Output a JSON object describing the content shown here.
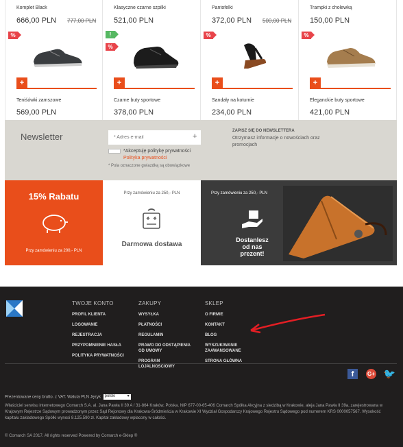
{
  "products": [
    {
      "top_name": "Komplet Black",
      "top_price": "666,00 PLN",
      "top_old_price": "777,00 PLN",
      "badges": [
        "sale"
      ],
      "name": "Teniśówki zamszowe",
      "price": "569,00 PLN",
      "shoe": "dark-sneaker-icon"
    },
    {
      "top_name": "Klasyczne czarne szpilki",
      "top_price": "521,00 PLN",
      "top_old_price": "",
      "badges": [
        "new",
        "sale"
      ],
      "name": "Czarne buty sportowe",
      "price": "378,00 PLN",
      "shoe": "black-sport-shoe-icon"
    },
    {
      "top_name": "Pantofelki",
      "top_price": "372,00 PLN",
      "top_old_price": "500,00 PLN",
      "badges": [
        "sale"
      ],
      "name": "Sandały na koturnie",
      "price": "234,00 PLN",
      "shoe": "wedge-sandal-icon"
    },
    {
      "top_name": "Trampki z cholewką",
      "top_price": "150,00 PLN",
      "top_old_price": "",
      "badges": [
        "sale"
      ],
      "name": "Eleganckie buty sportowe",
      "price": "421,00 PLN",
      "shoe": "tan-sneaker-icon"
    }
  ],
  "badge_text": {
    "sale": "%",
    "new": "!"
  },
  "add_label": "+",
  "newsletter": {
    "title": "Newsletter",
    "email_placeholder": "* Adres e-mail",
    "consent": "*Akceptuję politykę prywatności",
    "policy_link": "Polityka prywatności",
    "required_note": "* Pola oznaczone gwiazdką są obowiązkowe",
    "right_title": "ZAPISZ SIĘ DO NEWSLETTERA",
    "right_text": "Otrzymasz informacje o nowościach oraz promocjach"
  },
  "banners": {
    "discount_title": "15% Rabatu",
    "discount_text": "Przy zamówieniu za 200,- PLN",
    "delivery_text": "Przy zamówieniu za 250,- PLN",
    "delivery_title": "Darmowa dostawa",
    "photo_text": "Przy zamówieniu za 250,- PLN",
    "photo_title": "Dostanlesz od nas prezent!"
  },
  "footer": {
    "cols": [
      {
        "title": "TWOJE KONTO",
        "links": [
          "PROFIL KLIENTA",
          "LOGOWANIE",
          "REJESTRACJA",
          "PRZYPOMNIENIE HASŁA",
          "POLITYKA PRYWATNOŚCI"
        ]
      },
      {
        "title": "ZAKUPY",
        "links": [
          "WYSYŁKA",
          "PŁATNOŚCI",
          "REGULAMIN",
          "PRAWO DO ODSTĄPIENIA OD UMOWY",
          "PROGRAM LOJALNOŚCIOWY"
        ]
      },
      {
        "title": "SKLEP",
        "links": [
          "O FIRMIE",
          "KONTAKT",
          "BLOG",
          "WYSZUKIWANIE ZAAWANSOWANE",
          "STRONA GŁÓWNA"
        ]
      }
    ],
    "prices_note": "Prezentowane ceny brutto. z VAT. Waluta PLN Język",
    "language": "polski",
    "legal": "Właściciel serwisu internetowego Comarch S.A. al. Jana Pawła II 39 A / 31-864 Kraków, Polska. NIP 677-00-65-406 Comarch Spółka Akcyjna z siedzibą w Krakowie, aleja Jana Pawła II 39a, zarejestrowana w Krajowym Rejestrze Sądowym prowadzonym przez Sąd Rejonowy dla Krakowa-Śródmieścia w Krakowie XI Wydział Gospodarczy Krajowego Rejestru Sądowego pod numerem KRS 0000057567. Wysokość kapitału zakładowego Spółki wynosi 8.125.590 zł. Kapitał zakładowy wpłacony w całości.",
    "copyright": "© Comarch SA 2017. All rights reserved Powered by Comarch e-Sklep ®",
    "social": {
      "facebook": "f",
      "google": "G+",
      "twitter": "🐦"
    }
  },
  "colors": {
    "accent": "#e94e1b",
    "sale_badge": "#e8444a",
    "new_badge": "#56b862",
    "footer_bg": "#201e1e",
    "newsletter_bg": "#d9d7d1"
  }
}
